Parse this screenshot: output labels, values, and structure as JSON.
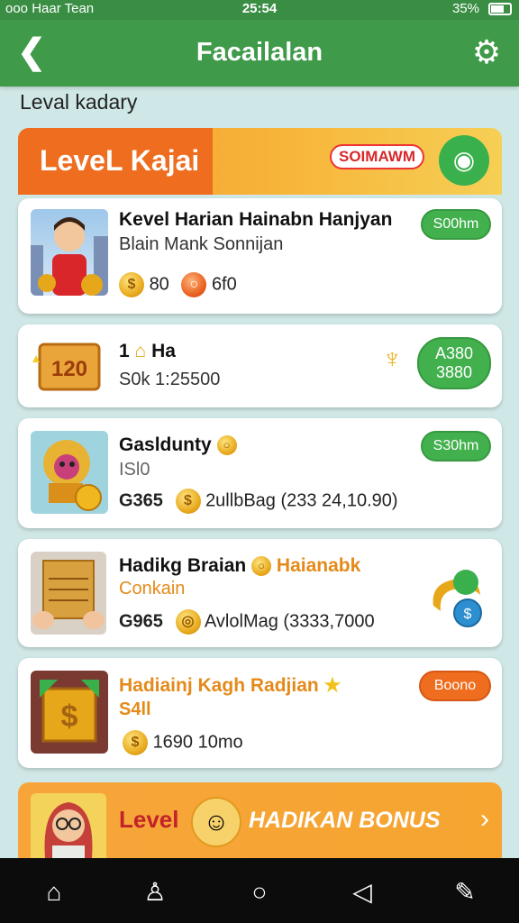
{
  "status_bar": {
    "carrier": "ooo Haar Tean",
    "time": "25:54",
    "battery": "35%"
  },
  "app_bar": {
    "title": "Facailalan"
  },
  "section_label": "Leval kadary",
  "header": {
    "title": "LeveL Kajai",
    "badge": "SOIMAWM"
  },
  "cards": [
    {
      "title": "Kevel Harian Hainabn Hanjyan",
      "sub": "Blain Mank Sonnijan",
      "stat1": "80",
      "stat2": "6f0",
      "pill": "S00hm"
    },
    {
      "title": "1",
      "title2": "Ha",
      "sub": "S0k 1:25500",
      "thumb_label": "120",
      "pill_line1": "A380",
      "pill_line2": "3880"
    },
    {
      "title": "Gasldunty",
      "sub": "ISl0",
      "stat_label": "G365",
      "stat_text": "2ullbBag (233 24,10.90)",
      "pill": "S30hm"
    },
    {
      "title": "Hadikg Braian",
      "title_accent": "Haianabk",
      "sub": "Conkain",
      "stat_label": "G965",
      "stat_text": "AvlolMag (3333,7000"
    },
    {
      "title": "Hadiainj Kagh Radjian",
      "sub": "S4ll",
      "stat": "1690 10mo",
      "pill": "Boono"
    }
  ],
  "bottom_banner": {
    "left_label": "Level",
    "cta": "HADIKAN BONUS"
  },
  "colors": {
    "primary_green": "#3f9a4a",
    "accent_orange": "#ee6d1f",
    "pill_green": "#3ab04d"
  },
  "icons": [
    "back-arrow-icon",
    "gear-icon",
    "coin-icon",
    "chevron-right-icon",
    "home-icon",
    "profile-icon",
    "circle-icon",
    "triangle-back-icon",
    "edit-icon"
  ]
}
